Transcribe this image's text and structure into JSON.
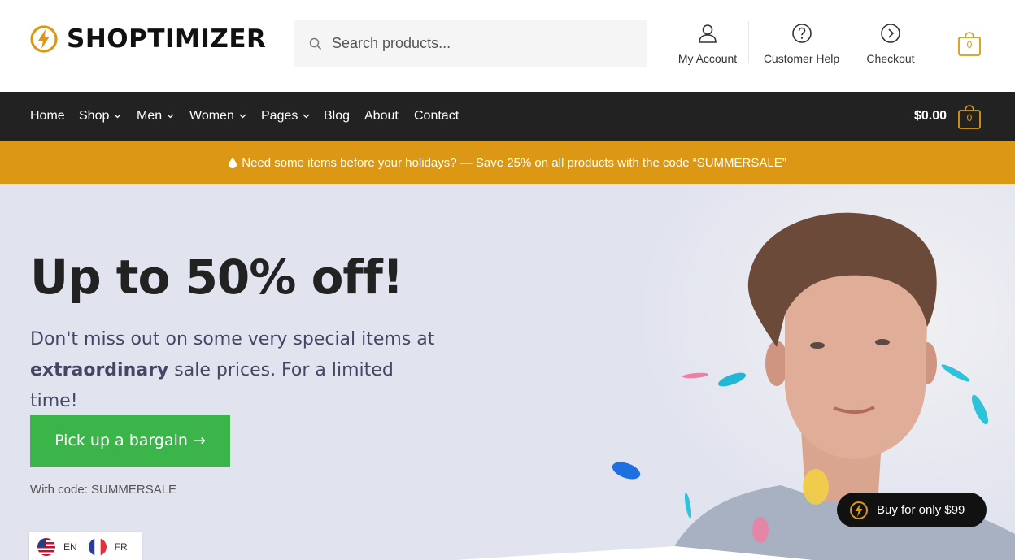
{
  "header": {
    "logo_text": "SHOPTIMIZER",
    "search": {
      "placeholder": "Search products..."
    },
    "links": [
      {
        "label": "My Account",
        "icon": "user-icon"
      },
      {
        "label": "Customer Help",
        "icon": "help-circle-icon"
      },
      {
        "label": "Checkout",
        "icon": "arrow-circle-icon"
      }
    ],
    "cart_count": "0"
  },
  "nav": {
    "items": [
      {
        "label": "Home"
      },
      {
        "label": "Shop"
      },
      {
        "label": "Men"
      },
      {
        "label": "Women"
      },
      {
        "label": "Pages"
      },
      {
        "label": "Blog"
      },
      {
        "label": "About"
      },
      {
        "label": "Contact"
      }
    ],
    "cart_total": "$0.00",
    "cart_count": "0"
  },
  "promo": {
    "text": "Need some items before your holidays? — Save 25% on all products with the code “SUMMERSALE”"
  },
  "hero": {
    "title": "Up to 50% off!",
    "text_before": "Don't miss out on some very special items at ",
    "text_bold": "extraordinary",
    "text_after": " sale prices. For a limited time!",
    "cta": "Pick up a bargain →",
    "code_note": "With code: SUMMERSALE"
  },
  "buy_pill": {
    "label": "Buy for only $99"
  },
  "language": {
    "items": [
      {
        "code": "EN",
        "icon": "us-flag-icon"
      },
      {
        "code": "FR",
        "icon": "france-flag-icon"
      }
    ]
  },
  "colors": {
    "nav_bg": "#222222",
    "promo_bg": "#dc9814",
    "accent": "#dc9814",
    "cta_bg": "#3bb54a",
    "hero_bg": "#e1e3ef"
  }
}
